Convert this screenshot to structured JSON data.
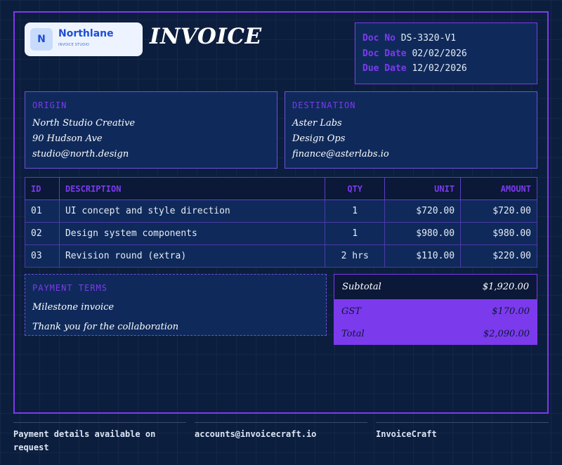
{
  "brand": {
    "initial": "N",
    "name": "Northlane",
    "tagline": "INVOICE STUDIO"
  },
  "title": "INVOICE",
  "meta": {
    "doc_no_label": "Doc No",
    "doc_no": "DS-3320-V1",
    "doc_date_label": "Doc Date",
    "doc_date": "02/02/2026",
    "due_date_label": "Due Date",
    "due_date": "12/02/2026"
  },
  "origin": {
    "label": "ORIGIN",
    "lines": [
      "North Studio Creative",
      "90 Hudson Ave",
      "studio@north.design"
    ]
  },
  "destination": {
    "label": "DESTINATION",
    "lines": [
      "Aster Labs",
      "Design Ops",
      "finance@asterlabs.io"
    ]
  },
  "table": {
    "headers": {
      "id": "ID",
      "description": "DESCRIPTION",
      "qty": "QTY",
      "unit": "UNIT",
      "amount": "AMOUNT"
    },
    "rows": [
      {
        "id": "01",
        "description": "UI concept and style direction",
        "qty": "1",
        "unit": "$720.00",
        "amount": "$720.00"
      },
      {
        "id": "02",
        "description": "Design system components",
        "qty": "1",
        "unit": "$980.00",
        "amount": "$980.00"
      },
      {
        "id": "03",
        "description": "Revision round (extra)",
        "qty": "2 hrs",
        "unit": "$110.00",
        "amount": "$220.00"
      }
    ]
  },
  "terms": {
    "label": "PAYMENT TERMS",
    "lines": [
      "Milestone invoice",
      "Thank you for the collaboration"
    ]
  },
  "totals": {
    "subtotal_label": "Subtotal",
    "subtotal": "$1,920.00",
    "gst_label": "GST",
    "gst": "$170.00",
    "total_label": "Total",
    "total": "$2,090.00"
  },
  "footer": {
    "payment": "Payment details available on request",
    "email": "accounts@invoicecraft.io",
    "company": "InvoiceCraft"
  },
  "colors": {
    "accent": "#7c3aed",
    "background": "#0c1e3e",
    "panel": "#0f2a5a",
    "brand": "#1d4ed8"
  }
}
